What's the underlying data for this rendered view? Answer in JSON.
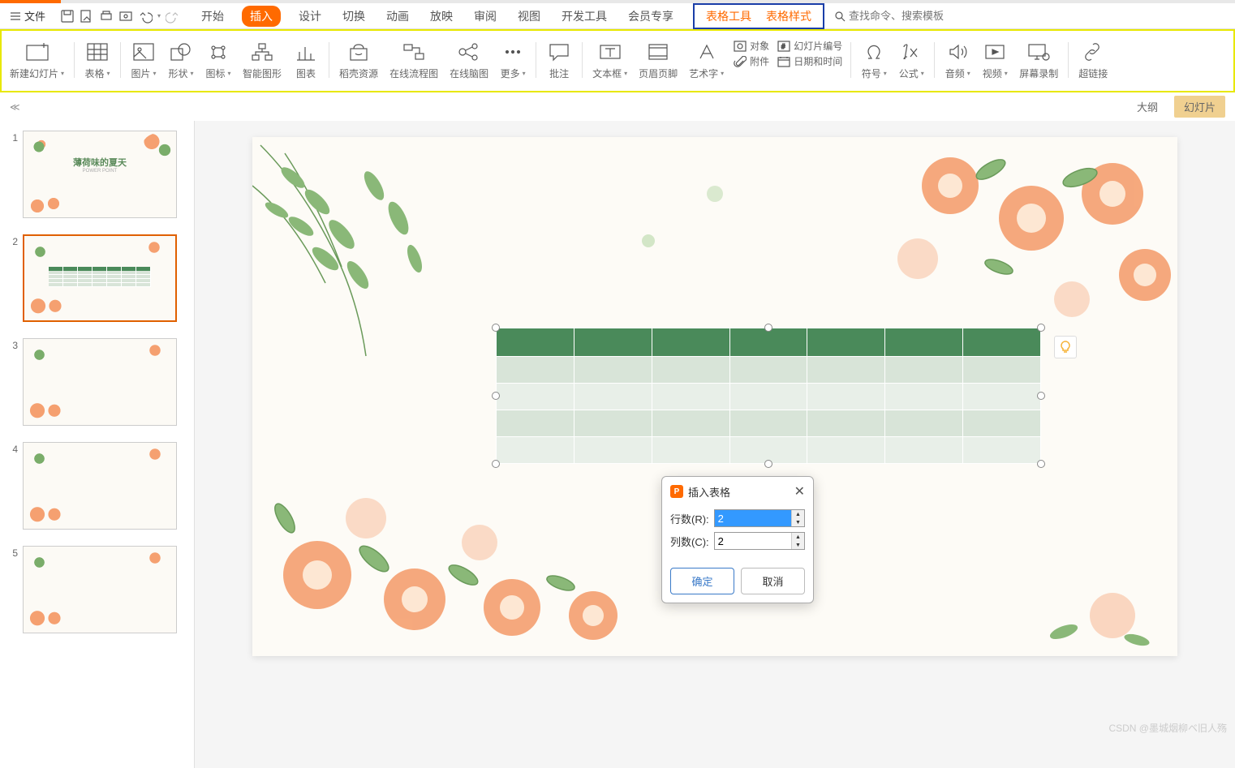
{
  "menu": {
    "file": "文件",
    "tabs": [
      "开始",
      "插入",
      "设计",
      "切换",
      "动画",
      "放映",
      "审阅",
      "视图",
      "开发工具",
      "会员专享"
    ],
    "active_tab": "插入",
    "contextual": [
      "表格工具",
      "表格样式"
    ],
    "search_placeholder": "查找命令、搜索模板"
  },
  "ribbon": {
    "new_slide": "新建幻灯片",
    "table": "表格",
    "image": "图片",
    "shape": "形状",
    "icon": "图标",
    "smart_art": "智能图形",
    "chart": "图表",
    "docer": "稻壳资源",
    "flowchart": "在线流程图",
    "mindmap": "在线脑图",
    "more": "更多",
    "comment": "批注",
    "textbox": "文本框",
    "header_footer": "页眉页脚",
    "wordart": "艺术字",
    "object": "对象",
    "attachment": "附件",
    "slide_number": "幻灯片编号",
    "date_time": "日期和时间",
    "symbol": "符号",
    "formula": "公式",
    "audio": "音频",
    "video": "视频",
    "screen_record": "屏幕录制",
    "hyperlink": "超链接"
  },
  "panel": {
    "outline": "大纲",
    "slides": "幻灯片"
  },
  "slides": {
    "items": [
      {
        "num": "1",
        "title": "薄荷味的夏天",
        "subtitle": "POWER POINT"
      },
      {
        "num": "2"
      },
      {
        "num": "3"
      },
      {
        "num": "4"
      },
      {
        "num": "5"
      }
    ]
  },
  "dialog": {
    "title": "插入表格",
    "rows_label": "行数(R):",
    "rows_value": "2",
    "cols_label": "列数(C):",
    "cols_value": "2",
    "ok": "确定",
    "cancel": "取消"
  },
  "watermark": "CSDN @墨城烟柳ベ旧人殇",
  "colors": {
    "accent": "#ff6a00",
    "table_header": "#4a8a5a",
    "table_cell": "#d8e4d8",
    "highlight_border": "#e8e800",
    "ctx_border": "#1a3ea8"
  }
}
